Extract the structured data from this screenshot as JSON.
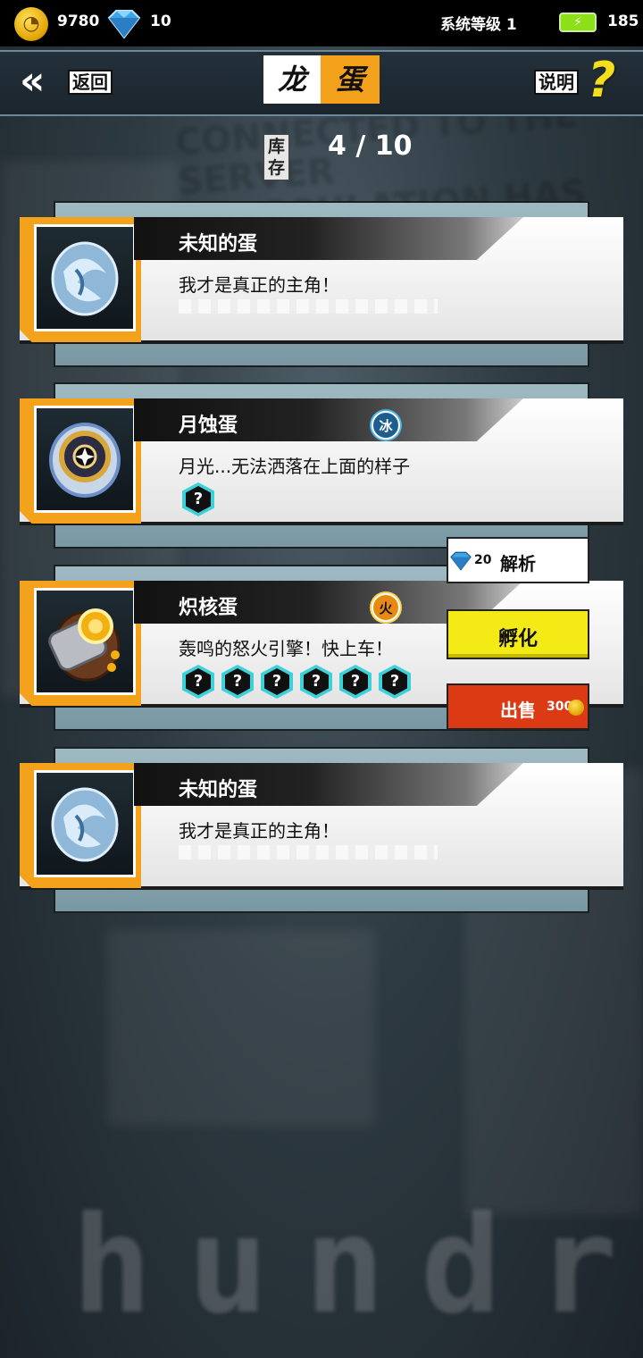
{
  "status": {
    "coins": "9780",
    "gems": "10",
    "system_level": "系统等级 1",
    "energy": "185"
  },
  "header": {
    "back_label": "返回",
    "title_left": "龙",
    "title_right": "蛋",
    "help_label": "说明",
    "help_symbol": "?"
  },
  "stock": {
    "label": "库存",
    "value": "4 / 10"
  },
  "eggs": [
    {
      "name": "未知的蛋",
      "desc": "我才是真正的主角！",
      "attribute": "",
      "skills": []
    },
    {
      "name": "月蚀蛋",
      "desc": "月光...无法洒落在上面的样子",
      "attribute": "冰",
      "skills": [
        "?"
      ]
    },
    {
      "name": "炽核蛋",
      "desc": "轰鸣的怒火引擎！快上车！",
      "attribute": "火",
      "skills": [
        "?",
        "?",
        "?",
        "?",
        "?",
        "?"
      ]
    },
    {
      "name": "未知的蛋",
      "desc": "我才是真正的主角！",
      "attribute": "",
      "skills": []
    }
  ],
  "actions": {
    "analyze_cost": "20",
    "analyze_label": "解析",
    "hatch_label": "孵化",
    "sell_label": "出售",
    "sell_price": "300"
  },
  "background": {
    "watermark": "hundr"
  },
  "colors": {
    "accent_orange": "#f4a21b",
    "hatch_yellow": "#f4ea16",
    "sell_red": "#dc3a14",
    "ice_blue": "#1e5e8e"
  }
}
